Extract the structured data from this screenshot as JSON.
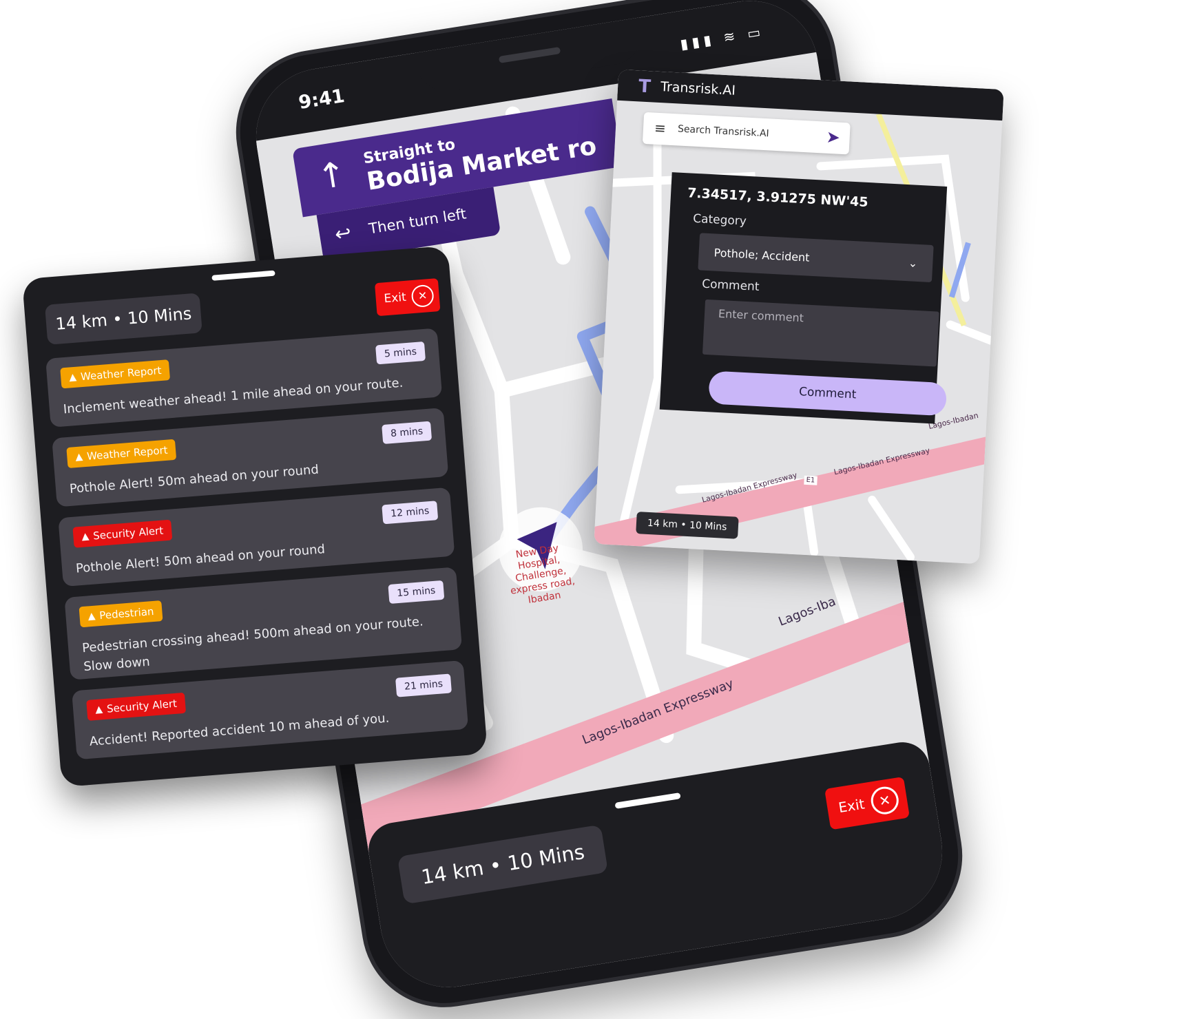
{
  "phone": {
    "status_time": "9:41",
    "status_icons": "▮▮▮ ≋ ▭",
    "nav": {
      "heading_small": "Straight to",
      "heading_big": "Bodija Market ro",
      "next_turn": "Then turn left",
      "up_arrow_icon": "↑",
      "turn_left_icon": "↩"
    },
    "map_labels": {
      "poi": "New Day Hospital, Challenge, express road, Ibadan",
      "road_1": "Lagos-Ibadan Expressway",
      "road_2": "Lagos-Iba"
    },
    "bottom": {
      "eta": "14 km • 10 Mins",
      "exit_label": "Exit",
      "exit_icon": "✕"
    }
  },
  "alerts_panel": {
    "eta": "14 km • 10 Mins",
    "exit_label": "Exit",
    "exit_icon": "✕",
    "warning_icon": "▲",
    "items": [
      {
        "category": "Weather Report",
        "time": "5 mins",
        "message": "Inclement weather ahead! 1 mile ahead on your route.",
        "color": "#f5a200"
      },
      {
        "category": "Weather Report",
        "time": "8 mins",
        "message": "Pothole Alert! 50m ahead on your round",
        "color": "#f5a200"
      },
      {
        "category": "Security Alert",
        "time": "12 mins",
        "message": "Pothole Alert! 50m ahead on your round",
        "color": "#e41212"
      },
      {
        "category": "Pedestrian",
        "time": "15 mins",
        "message": "Pedestrian crossing ahead! 500m ahead on your route. Slow down",
        "color": "#f5a200"
      },
      {
        "category": "Security Alert",
        "time": "21 mins",
        "message": "Accident! Reported accident 10 m ahead of you.",
        "color": "#e41212"
      }
    ]
  },
  "report_panel": {
    "brand": "Transrisk.AI",
    "logo_icon": "T",
    "search_placeholder": "Search Transrisk.AI",
    "menu_icon": "≡",
    "send_icon": "➤",
    "coordinates": "7.34517, 3.91275 NW'45",
    "category_label": "Category",
    "category_value": "Pothole; Accident",
    "chevron_icon": "⌄",
    "comment_label": "Comment",
    "comment_placeholder": "Enter comment",
    "comment_button": "Comment",
    "road_label_1": "Lagos-Ibadan Expressway",
    "road_label_2": "Lagos-Ibadan Expressway",
    "road_label_3": "Lagos-Ibadan",
    "road_code": "E1",
    "eta": "14 km • 10 Mins"
  },
  "colors": {
    "accent_purple": "#4a2a8c",
    "exit_red": "#f01010",
    "panel_dark": "#1d1d21",
    "card": "#46444c",
    "comment_button": "#c9b6f8",
    "road_pink": "#f1a9b9",
    "route_blue": "#8fa8f0"
  }
}
